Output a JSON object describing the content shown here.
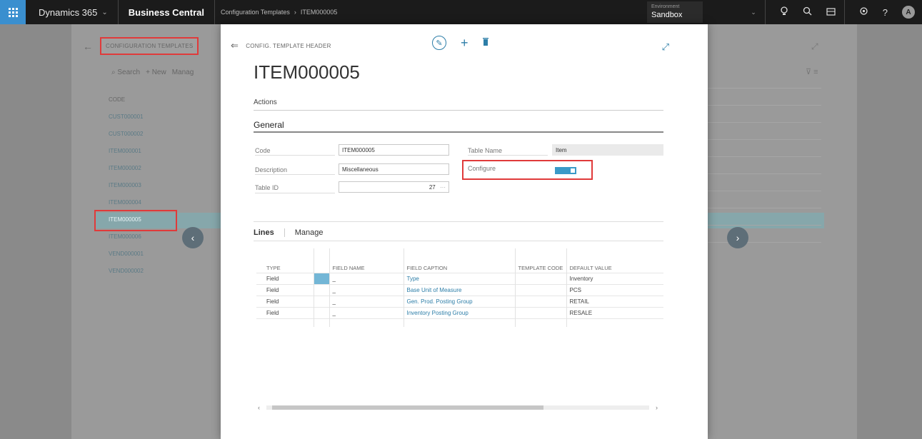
{
  "topbar": {
    "brand": "Dynamics 365",
    "brand_chevron": "⌄",
    "product": "Business Central",
    "breadcrumb": [
      "Configuration Templates",
      "›",
      "ITEM000005"
    ],
    "env_label": "Environment",
    "env_value": "Sandbox",
    "avatar_initial": "A"
  },
  "background": {
    "title": "CONFIGURATION TEMPLATES",
    "toolbar": {
      "search": "Search",
      "new": "+ New",
      "manage": "Manag"
    },
    "column": "CODE",
    "codes": [
      "CUST000001",
      "CUST000002",
      "ITEM000001",
      "ITEM000002",
      "ITEM000003",
      "ITEM000004",
      "ITEM000005",
      "ITEM000006",
      "VEND000001",
      "VEND000002"
    ]
  },
  "dialog": {
    "caption": "CONFIG. TEMPLATE HEADER",
    "title": "ITEM000005",
    "actions_label": "Actions",
    "general_label": "General",
    "fields": {
      "code_label": "Code",
      "code_value": "ITEM000005",
      "description_label": "Description",
      "description_value": "Miscellaneous",
      "table_id_label": "Table ID",
      "table_id_value": "27",
      "table_id_dots": "···",
      "table_name_label": "Table Name",
      "table_name_value": "Item",
      "configure_label": "Configure",
      "configure_on": true
    },
    "lines_tab": "Lines",
    "manage_tab": "Manage",
    "columns": [
      "TYPE",
      "",
      "FIELD NAME",
      "FIELD CAPTION",
      "TEMPLATE CODE",
      "DEFAULT VALUE"
    ],
    "rows": [
      {
        "type": "Field",
        "field_name": "_",
        "caption": "Type",
        "template_code": "",
        "default": "Inventory"
      },
      {
        "type": "Field",
        "field_name": "_",
        "caption": "Base Unit of Measure",
        "template_code": "",
        "default": "PCS"
      },
      {
        "type": "Field",
        "field_name": "_",
        "caption": "Gen. Prod. Posting Group",
        "template_code": "",
        "default": "RETAIL"
      },
      {
        "type": "Field",
        "field_name": "_",
        "caption": "Inventory Posting Group",
        "template_code": "",
        "default": "RESALE"
      }
    ]
  },
  "colors": {
    "accent": "#2d7ea8",
    "highlight": "#e03a3a",
    "toggle": "#3a9ac8"
  }
}
